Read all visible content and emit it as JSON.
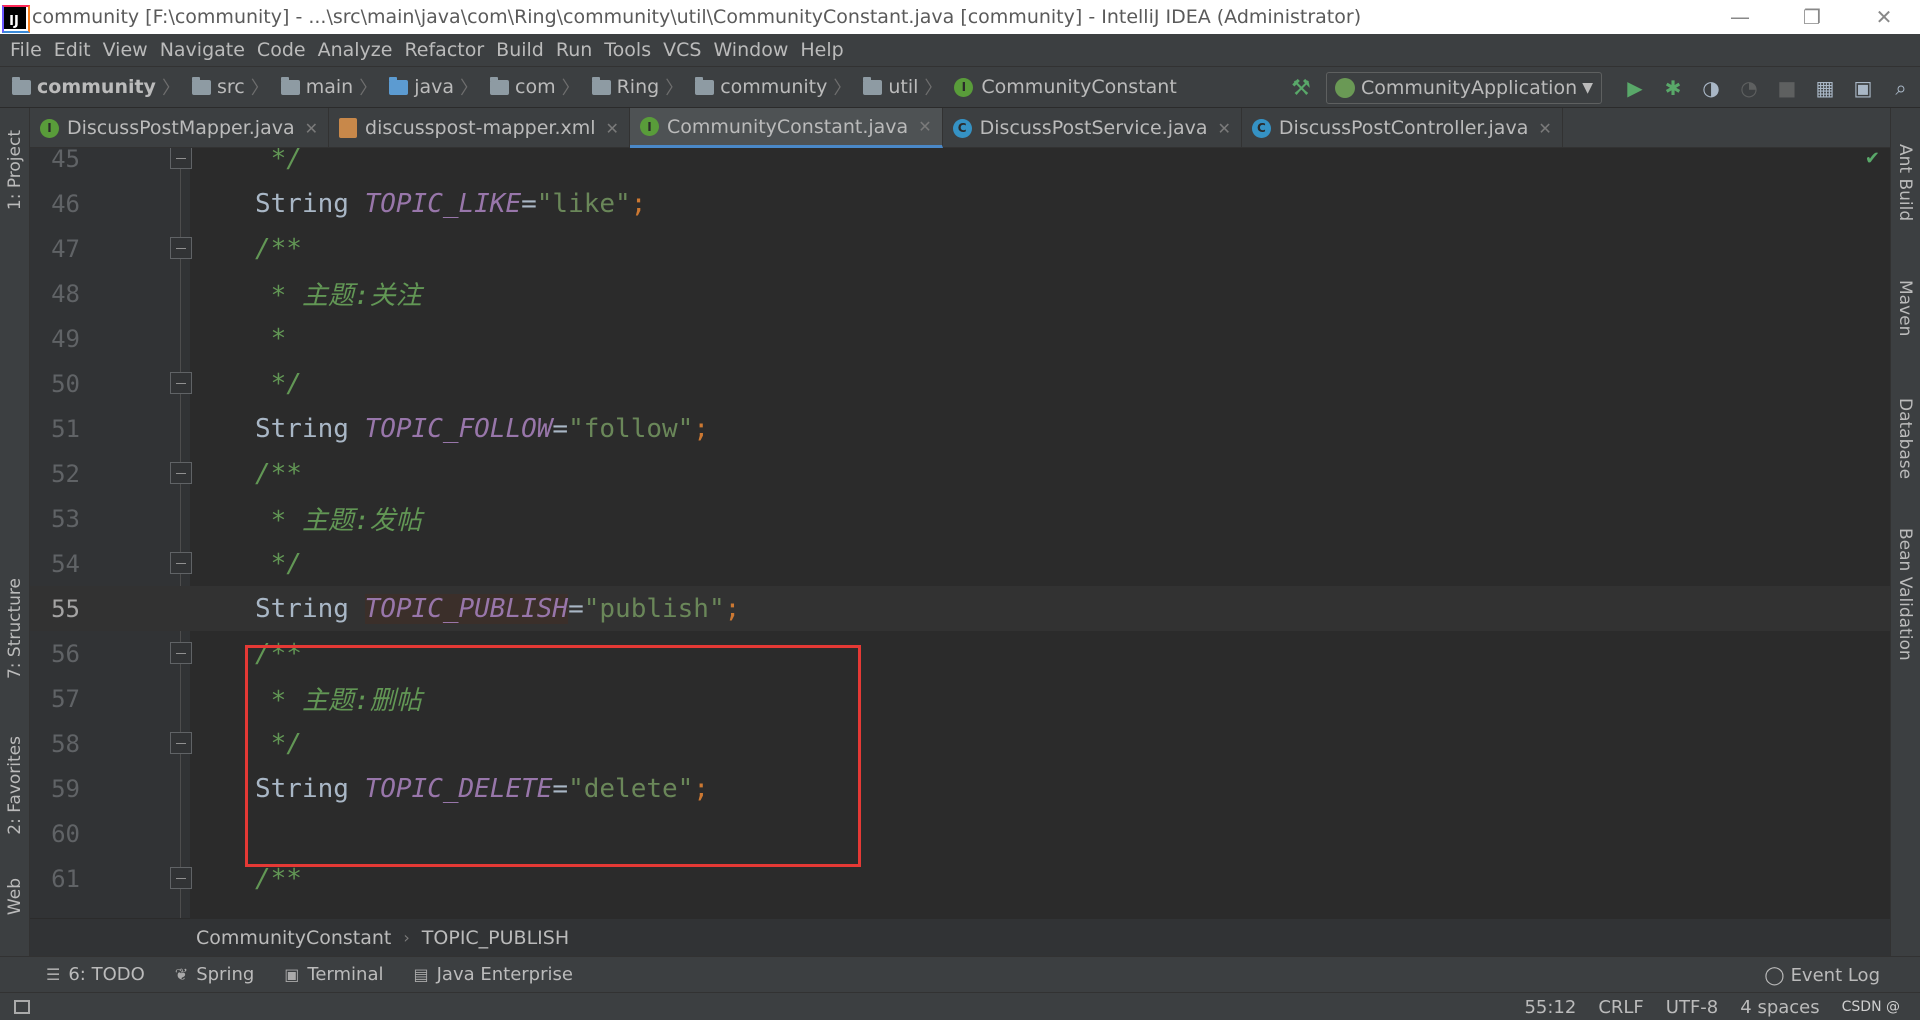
{
  "window": {
    "title": "community [F:\\community] - ...\\src\\main\\java\\com\\Ring\\community\\util\\CommunityConstant.java [community] - IntelliJ IDEA (Administrator)",
    "minimize": "—",
    "restore": "❐",
    "close": "✕"
  },
  "menu": [
    "File",
    "Edit",
    "View",
    "Navigate",
    "Code",
    "Analyze",
    "Refactor",
    "Build",
    "Run",
    "Tools",
    "VCS",
    "Window",
    "Help"
  ],
  "breadcrumbs": [
    "community",
    "src",
    "main",
    "java",
    "com",
    "Ring",
    "community",
    "util",
    "CommunityConstant"
  ],
  "run_config": "CommunityApplication",
  "tabs": [
    {
      "label": "DiscussPostMapper.java",
      "icon": "interface-icon"
    },
    {
      "label": "discusspost-mapper.xml",
      "icon": "xml-icon"
    },
    {
      "label": "CommunityConstant.java",
      "icon": "interface-icon",
      "active": true
    },
    {
      "label": "DiscussPostService.java",
      "icon": "class-icon"
    },
    {
      "label": "DiscussPostController.java",
      "icon": "class-icon"
    }
  ],
  "left_tools": [
    "1: Project",
    "7: Structure",
    "2: Favorites",
    "Web"
  ],
  "right_tools": [
    "Ant Build",
    "Maven",
    "Database",
    "Bean Validation"
  ],
  "code_lines": [
    {
      "n": "45",
      "doc": " */"
    },
    {
      "n": "46",
      "kw": "String ",
      "name": "TOPIC_LIKE",
      "eq": "=",
      "str": "\"like\"",
      "semi": ";"
    },
    {
      "n": "47",
      "doc": "/**"
    },
    {
      "n": "48",
      "doc": " * 主题:关注"
    },
    {
      "n": "49",
      "doc": " *"
    },
    {
      "n": "50",
      "doc": " */"
    },
    {
      "n": "51",
      "kw": "String ",
      "name": "TOPIC_FOLLOW",
      "eq": "=",
      "str": "\"follow\"",
      "semi": ";"
    },
    {
      "n": "52",
      "doc": "/**"
    },
    {
      "n": "53",
      "doc": " * 主题:发帖"
    },
    {
      "n": "54",
      "doc": " */"
    },
    {
      "n": "55",
      "kw": "String ",
      "name": "TOPIC_PUBLISH",
      "eq": "=",
      "str": "\"publish\"",
      "semi": ";"
    },
    {
      "n": "56",
      "doc": "/**"
    },
    {
      "n": "57",
      "doc": " * 主题:删帖"
    },
    {
      "n": "58",
      "doc": " */"
    },
    {
      "n": "59",
      "kw": "String ",
      "name": "TOPIC_DELETE",
      "eq": "=",
      "str": "\"delete\"",
      "semi": ";"
    },
    {
      "n": "60",
      "doc": ""
    },
    {
      "n": "61",
      "doc": "/**"
    }
  ],
  "editor_breadcrumb": [
    "CommunityConstant",
    "TOPIC_PUBLISH"
  ],
  "tool_windows": [
    "6: TODO",
    "Spring",
    "Terminal",
    "Java Enterprise"
  ],
  "event_log": "Event Log",
  "status": {
    "position": "55:12",
    "line_sep": "CRLF",
    "encoding": "UTF-8",
    "indent": "4 spaces",
    "watermark": "CSDN @"
  }
}
